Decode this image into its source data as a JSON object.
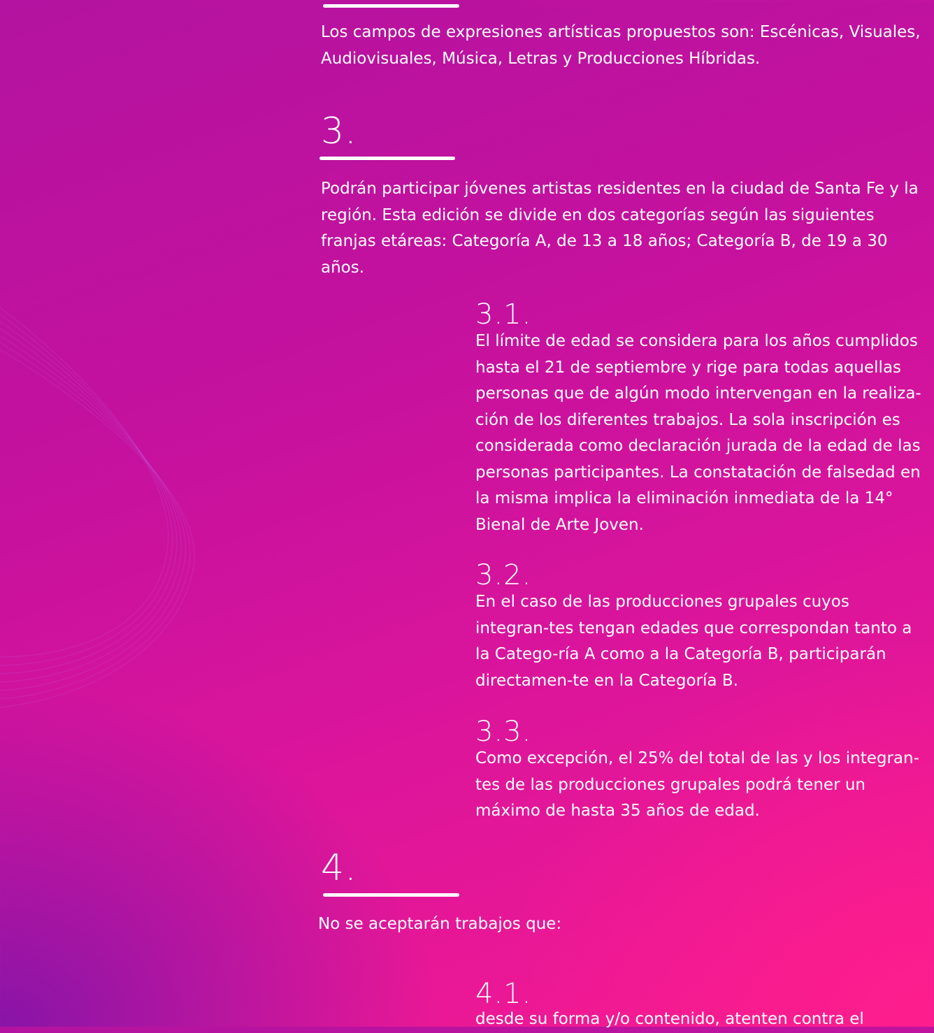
{
  "intro": {
    "text": "Los campos de expresiones artísticas propuestos son: Escénicas, Visuales, Audiovisuales, Música, Letras y Producciones Híbridas."
  },
  "section3": {
    "number": "3.",
    "text": "Podrán participar jóvenes artistas residentes en la ciudad de Santa Fe y la región. Esta edición se divide en dos categorías según las siguientes franjas etáreas: Categoría A, de 13 a 18 años; Categoría B, de 19 a 30 años.",
    "items": [
      {
        "number": "3.1.",
        "text": "El límite de edad se considera para los años cumplidos hasta el 21 de septiembre y rige para todas aquellas personas que de algún modo intervengan en la realiza-ción de los diferentes trabajos. La sola inscripción es considerada como declaración jurada de la edad de las personas participantes. La constatación de falsedad en la misma implica la eliminación inmediata de la 14° Bienal de Arte Joven."
      },
      {
        "number": "3.2.",
        "text": "En el caso de las producciones grupales cuyos integran-tes tengan edades que correspondan tanto a la Catego-ría A como a la Categoría B, participarán directamen-te en la Categoría B."
      },
      {
        "number": "3.3.",
        "text": "Como excepción, el 25% del total de las y los integran-tes de las producciones grupales podrá tener un máximo de hasta 35 años de edad."
      }
    ]
  },
  "section4": {
    "number": "4.",
    "text": "No se aceptarán trabajos que:",
    "items": [
      {
        "number": "4.1.",
        "text": "desde su forma y/o contenido, atenten contra el"
      }
    ]
  },
  "colors": {
    "background_top": "#b313a0",
    "background_bottom_right": "#ff1e8c",
    "background_bottom_left": "#7814aa",
    "text": "#ffffff"
  }
}
